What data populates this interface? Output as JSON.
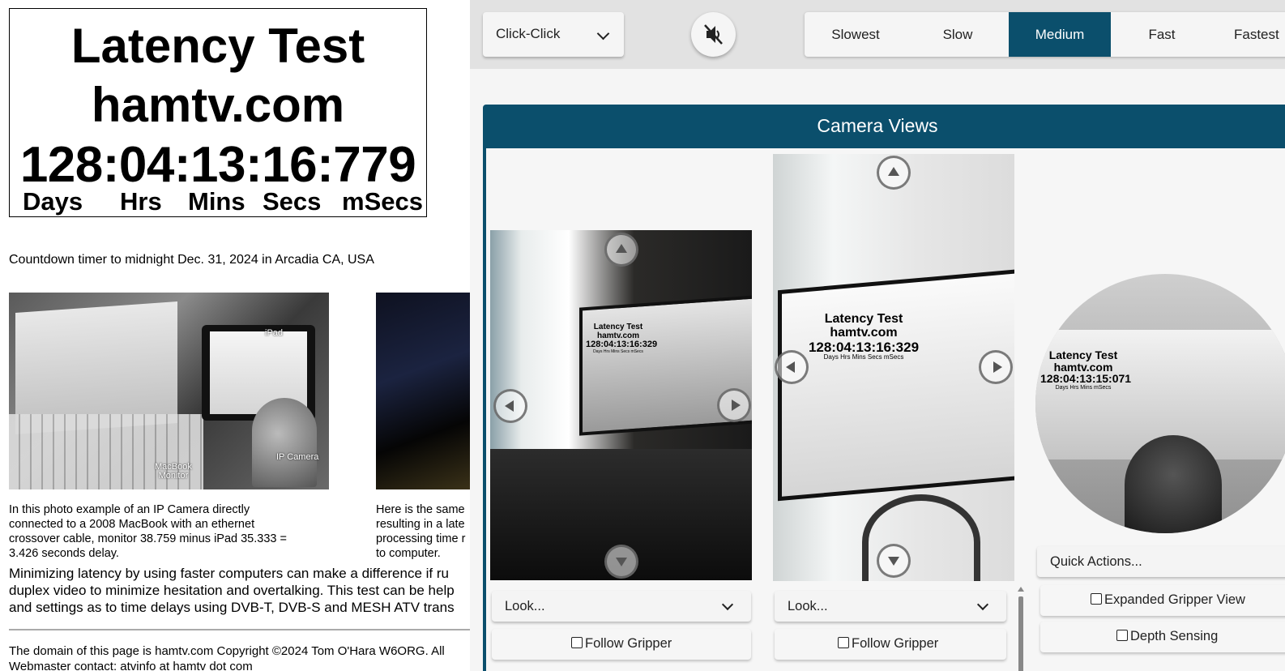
{
  "left_page": {
    "title_line1": "Latency Test",
    "title_line2": "hamtv.com",
    "timer": "128:04:13:16:779",
    "units": [
      "Days",
      "Hrs",
      "Mins",
      "Secs",
      "mSecs"
    ],
    "countdown_text": "Countdown timer to midnight Dec. 31, 2024 in Arcadia CA, USA",
    "photo1_labels": {
      "ipad": "iPad",
      "camera": "IP Camera",
      "monitor_line1": "MacBook",
      "monitor_line2": "Monitor"
    },
    "caption1": [
      "In this photo example of an IP Camera directly",
      "connected to a 2008 MacBook with an ethernet",
      "crossover cable, monitor 38.759 minus iPad 35.333 =",
      "3.426 seconds delay."
    ],
    "caption2": [
      "Here is the same",
      "resulting in a late",
      "processing time r",
      "to computer."
    ],
    "paragraph": [
      "Minimizing latency by using faster computers can make a difference if ru",
      "duplex video to minimize hesitation and overtalking. This test can be help",
      "and settings as to time delays using DVB-T, DVB-S and MESH ATV trans"
    ],
    "footer_line1": "The domain of this page is hamtv.com Copyright ©2024 Tom O'Hara W6ORG. All",
    "footer_line2": "Webmaster contact: atvinfo at hamtv dot com"
  },
  "toolbar": {
    "mode_value": "Click-Click",
    "mute_icon": "volume-mute-icon",
    "speeds": [
      "Slowest",
      "Slow",
      "Medium",
      "Fast",
      "Fastest"
    ],
    "active_speed": "Medium",
    "accent_color": "#0b4f6c"
  },
  "camera_panel": {
    "title": "Camera Views",
    "feed1_overlay": [
      "Latency Test",
      "hamtv.com",
      "128:04:13:16:329",
      "Days  Hrs  Mins  Secs  mSecs"
    ],
    "feed2_overlay": [
      "Latency Test",
      "hamtv.com",
      "128:04:13:16:329",
      "Days  Hrs  Mins  Secs  mSecs"
    ],
    "feed3_overlay": [
      "Latency Test",
      "hamtv.com",
      "128:04:13:15:071",
      "Days  Hrs  Mins  mSecs"
    ],
    "look_placeholder_1": "Look...",
    "look_placeholder_2": "Look...",
    "follow_gripper_1": "Follow Gripper",
    "follow_gripper_2": "Follow Gripper",
    "quick_actions": "Quick Actions...",
    "expanded_gripper": "Expanded Gripper View",
    "depth_sensing": "Depth Sensing"
  }
}
